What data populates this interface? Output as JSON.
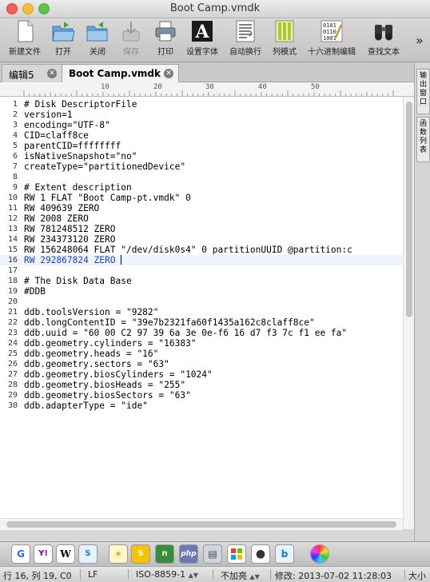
{
  "window": {
    "title": "Boot Camp.vmdk"
  },
  "toolbar": {
    "buttons": [
      {
        "label": "新建文件",
        "icon": "new-file-icon",
        "enabled": true
      },
      {
        "label": "打开",
        "icon": "open-folder-icon",
        "enabled": true
      },
      {
        "label": "关闭",
        "icon": "close-folder-icon",
        "enabled": true
      },
      {
        "label": "保存",
        "icon": "save-icon",
        "enabled": false
      },
      {
        "label": "打印",
        "icon": "printer-icon",
        "enabled": true
      },
      {
        "label": "设置字体",
        "icon": "font-icon",
        "enabled": true
      },
      {
        "label": "自动换行",
        "icon": "word-wrap-icon",
        "enabled": true
      },
      {
        "label": "列模式",
        "icon": "column-mode-icon",
        "enabled": true
      },
      {
        "label": "十六进制编辑",
        "icon": "hex-edit-icon",
        "enabled": true
      },
      {
        "label": "查找文本",
        "icon": "binoculars-icon",
        "enabled": true
      }
    ],
    "overflow": "»"
  },
  "tabs": [
    {
      "label": "编辑5",
      "active": false
    },
    {
      "label": "Boot Camp.vmdk",
      "active": true
    }
  ],
  "ruler": {
    "marks": [
      "10",
      "20",
      "30",
      "40",
      "50"
    ]
  },
  "editor": {
    "current_line": 16,
    "lines": [
      "# Disk DescriptorFile",
      "version=1",
      "encoding=\"UTF-8\"",
      "CID=claff8ce",
      "parentCID=ffffffff",
      "isNativeSnapshot=\"no\"",
      "createType=\"partitionedDevice\"",
      "",
      "# Extent description",
      "RW 1 FLAT \"Boot Camp-pt.vmdk\" 0",
      "RW 409639 ZERO",
      "RW 2008 ZERO",
      "RW 781248512 ZERO",
      "RW 234373120 ZERO",
      "RW 156248064 FLAT \"/dev/disk0s4\" 0 partitionUUID @partition:c",
      "RW 292867824 ZERO ",
      "",
      "# The Disk Data Base",
      "#DDB",
      "",
      "ddb.toolsVersion = \"9282\"",
      "ddb.longContentID = \"39e7b2321fa60f1435a162c8claff8ce\"",
      "ddb.uuid = \"60 00 C2 97 39 6a 3e 0e-f6 16 d7 f3 7c f1 ee fa\"",
      "ddb.geometry.cylinders = \"16383\"",
      "ddb.geometry.heads = \"16\"",
      "ddb.geometry.sectors = \"63\"",
      "ddb.geometry.biosCylinders = \"1024\"",
      "ddb.geometry.biosHeads = \"255\"",
      "ddb.geometry.biosSectors = \"63\"",
      "ddb.adapterType = \"ide\""
    ]
  },
  "side_panel": {
    "tabs": [
      "输出窗口",
      "函数列表"
    ]
  },
  "dock": {
    "icons": [
      "google-icon",
      "yahoo-icon",
      "wikipedia-icon",
      "sogou-icon",
      "baidu-icon",
      "soso-icon",
      "nhn-icon",
      "php-icon",
      "bookmarks-icon",
      "windows-icon",
      "apple-icon",
      "bing-icon",
      "color-wheel-icon"
    ]
  },
  "status": {
    "position": "行 16, 列 19, C0",
    "line_ending": "LF",
    "encoding": "ISO-8859-1",
    "encrypt": "不加亮",
    "modified": "修改: 2013-07-02 11:28:03",
    "size": "大小"
  }
}
